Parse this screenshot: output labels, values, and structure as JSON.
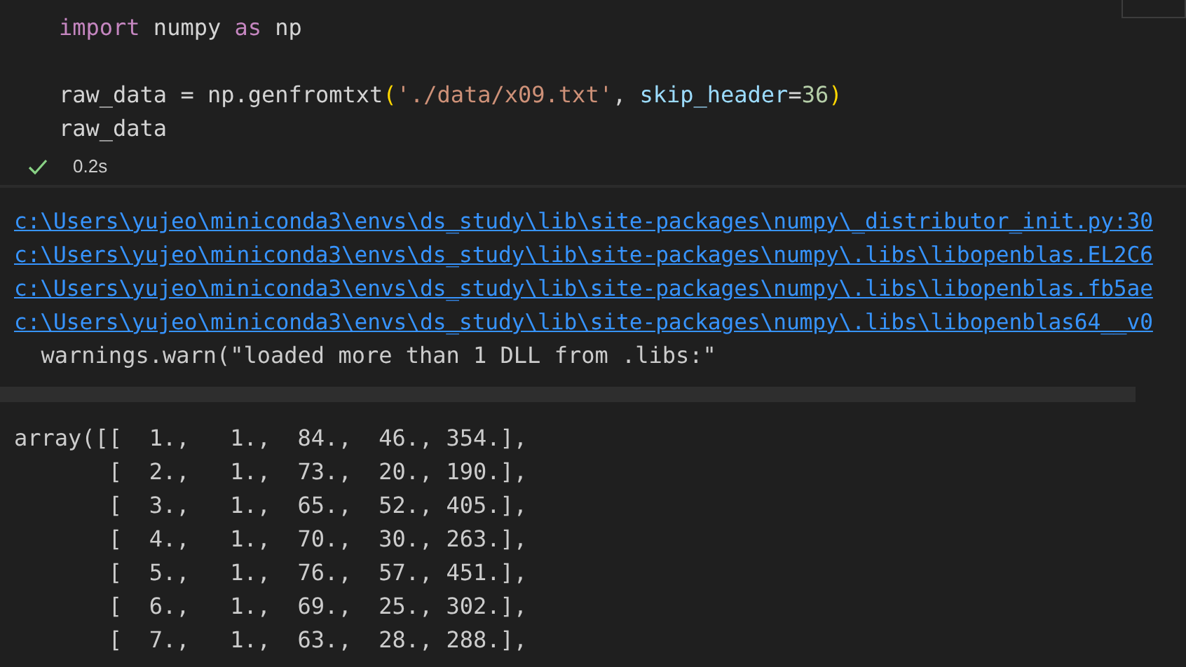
{
  "code_cell": {
    "blocks": [
      [
        [
          {
            "kind": "keyword",
            "text": "import"
          },
          {
            "kind": "plain",
            "text": " numpy "
          },
          {
            "kind": "keyword",
            "text": "as"
          },
          {
            "kind": "plain",
            "text": " np"
          }
        ]
      ],
      [
        [
          {
            "kind": "plain",
            "text": "raw_data = np.genfromtxt"
          },
          {
            "kind": "paren",
            "text": "("
          },
          {
            "kind": "string",
            "text": "'./data/x09.txt'"
          },
          {
            "kind": "plain",
            "text": ", "
          },
          {
            "kind": "param",
            "text": "skip_header"
          },
          {
            "kind": "plain",
            "text": "="
          },
          {
            "kind": "number",
            "text": "36"
          },
          {
            "kind": "paren",
            "text": ")"
          }
        ],
        [
          {
            "kind": "plain",
            "text": "raw_data"
          }
        ]
      ]
    ],
    "status": {
      "success": true,
      "duration": "0.2s"
    }
  },
  "output": {
    "stderr": [
      {
        "kind": "link",
        "text": "c:\\Users\\yujeo\\miniconda3\\envs\\ds_study\\lib\\site-packages\\numpy\\_distributor_init.py:30"
      },
      {
        "kind": "link",
        "text": "c:\\Users\\yujeo\\miniconda3\\envs\\ds_study\\lib\\site-packages\\numpy\\.libs\\libopenblas.EL2C6"
      },
      {
        "kind": "link",
        "text": "c:\\Users\\yujeo\\miniconda3\\envs\\ds_study\\lib\\site-packages\\numpy\\.libs\\libopenblas.fb5ae"
      },
      {
        "kind": "link",
        "text": "c:\\Users\\yujeo\\miniconda3\\envs\\ds_study\\lib\\site-packages\\numpy\\.libs\\libopenblas64__v0"
      },
      {
        "kind": "text",
        "text": "  warnings.warn(\"loaded more than 1 DLL from .libs:\""
      }
    ],
    "result": [
      "array([[  1.,   1.,  84.,  46., 354.],",
      "       [  2.,   1.,  73.,  20., 190.],",
      "       [  3.,   1.,  65.,  52., 405.],",
      "       [  4.,   1.,  70.,  30., 263.],",
      "       [  5.,   1.,  76.,  57., 451.],",
      "       [  6.,   1.,  69.,  25., 302.],",
      "       [  7.,   1.,  63.,  28., 288.],"
    ]
  }
}
